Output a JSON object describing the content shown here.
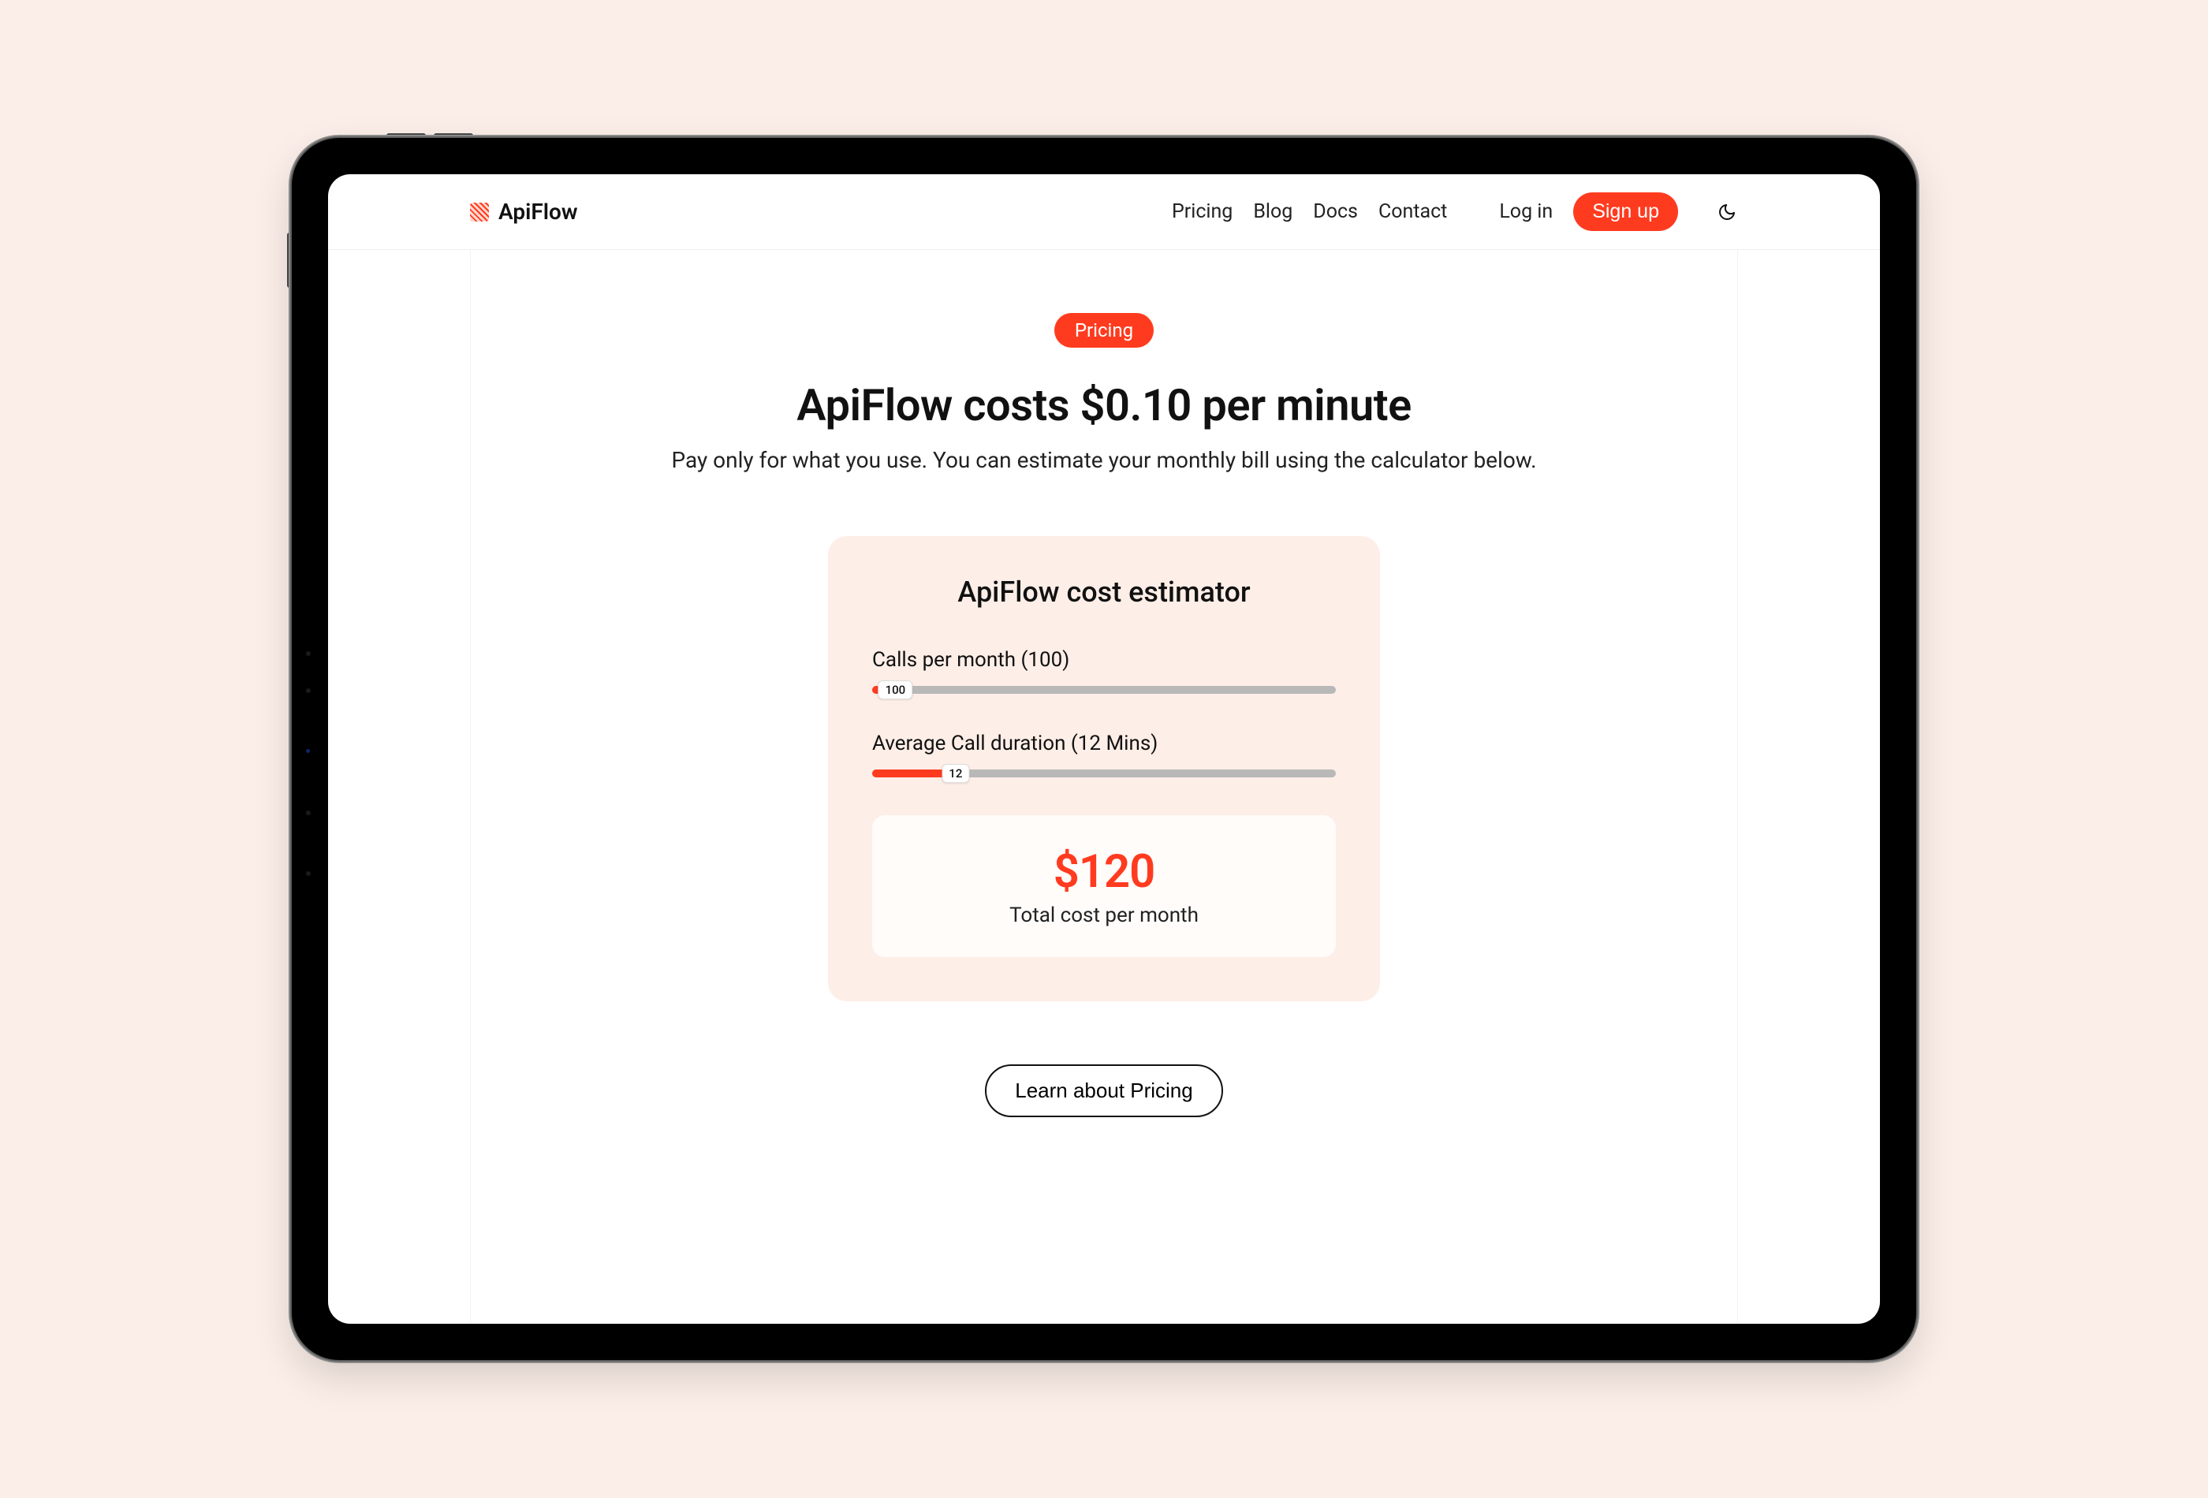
{
  "brand": {
    "name": "ApiFlow"
  },
  "nav": {
    "items": [
      "Pricing",
      "Blog",
      "Docs",
      "Contact"
    ],
    "login": "Log in",
    "signup": "Sign up"
  },
  "hero": {
    "badge": "Pricing",
    "title": "ApiFlow costs $0.10 per minute",
    "subtitle": "Pay only for what you use. You can estimate your monthly bill using the calculator below."
  },
  "estimator": {
    "heading": "ApiFlow cost estimator",
    "sliders": {
      "calls": {
        "label": "Calls per month (100)",
        "value": 100,
        "thumb_text": "100",
        "fill_percent": 5
      },
      "duration": {
        "label": "Average Call duration (12 Mins)",
        "value": 12,
        "thumb_text": "12",
        "fill_percent": 18
      }
    },
    "result": {
      "amount": "$120",
      "caption": "Total cost per month"
    }
  },
  "cta": {
    "learn": "Learn about Pricing"
  },
  "colors": {
    "accent": "#ff3b1f",
    "card_bg": "#fdeee7",
    "page_bg": "#fbeee8"
  }
}
